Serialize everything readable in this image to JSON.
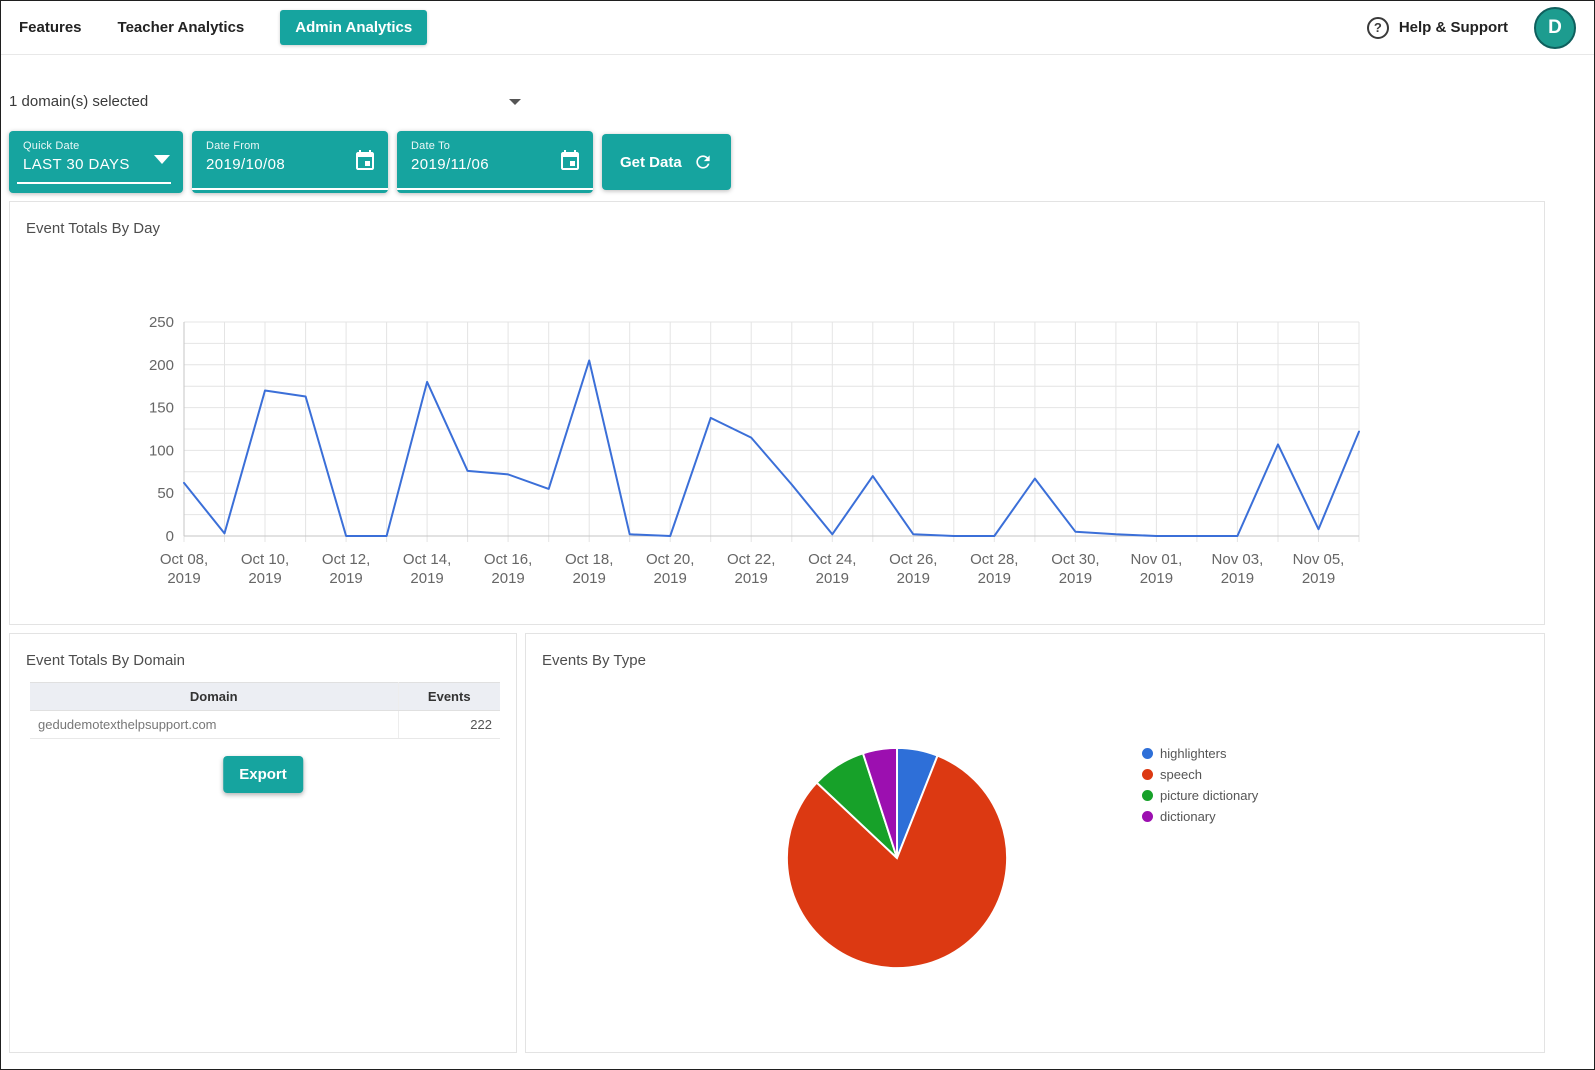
{
  "theme": {
    "accent_color": "#16a49f"
  },
  "nav": {
    "items": [
      {
        "label": "Features"
      },
      {
        "label": "Teacher Analytics"
      },
      {
        "label": "Admin Analytics",
        "active": true
      }
    ],
    "help_label": "Help & Support",
    "avatar_initial": "D"
  },
  "filters": {
    "domain_selector_value": "1 domain(s) selected",
    "quick_date": {
      "label": "Quick Date",
      "value": "LAST 30 DAYS"
    },
    "date_from": {
      "label": "Date From",
      "value": "2019/10/08"
    },
    "date_to": {
      "label": "Date To",
      "value": "2019/11/06"
    },
    "get_data_label": "Get Data"
  },
  "panels": {
    "events_by_day_title": "Event Totals By Day",
    "events_by_domain_title": "Event Totals By Domain",
    "events_by_type_title": "Events By Type"
  },
  "domain_table": {
    "headers": [
      "Domain",
      "Events"
    ],
    "rows": [
      {
        "domain": "gedudemotexthelpsupport.com",
        "events": "222"
      }
    ],
    "export_label": "Export"
  },
  "chart_data": [
    {
      "type": "line",
      "title": "Event Totals By Day",
      "x": [
        "Oct 08, 2019",
        "Oct 09, 2019",
        "Oct 10, 2019",
        "Oct 11, 2019",
        "Oct 12, 2019",
        "Oct 13, 2019",
        "Oct 14, 2019",
        "Oct 15, 2019",
        "Oct 16, 2019",
        "Oct 17, 2019",
        "Oct 18, 2019",
        "Oct 19, 2019",
        "Oct 20, 2019",
        "Oct 21, 2019",
        "Oct 22, 2019",
        "Oct 23, 2019",
        "Oct 24, 2019",
        "Oct 25, 2019",
        "Oct 26, 2019",
        "Oct 27, 2019",
        "Oct 28, 2019",
        "Oct 29, 2019",
        "Oct 30, 2019",
        "Oct 31, 2019",
        "Nov 01, 2019",
        "Nov 02, 2019",
        "Nov 03, 2019",
        "Nov 04, 2019",
        "Nov 05, 2019",
        "Nov 06, 2019"
      ],
      "values": [
        62,
        3,
        170,
        163,
        0,
        0,
        180,
        76,
        72,
        55,
        205,
        2,
        0,
        138,
        115,
        60,
        2,
        70,
        2,
        0,
        0,
        67,
        5,
        2,
        0,
        0,
        0,
        107,
        8,
        122
      ],
      "x_tick_every": 2,
      "ylim": [
        0,
        250
      ],
      "y_ticks": [
        0,
        50,
        100,
        150,
        200,
        250
      ],
      "y_minor_step": 25,
      "grid": true,
      "line_color": "#3b6fd8"
    },
    {
      "type": "pie",
      "title": "Events By Type",
      "labels": [
        "highlighters",
        "speech",
        "picture dictionary",
        "dictionary"
      ],
      "values": [
        6,
        81,
        8,
        5
      ],
      "unit": "percent_estimated",
      "colors": [
        "#2e6fd8",
        "#dc3912",
        "#17a129",
        "#9c0fb0"
      ],
      "legend_position": "right"
    }
  ]
}
